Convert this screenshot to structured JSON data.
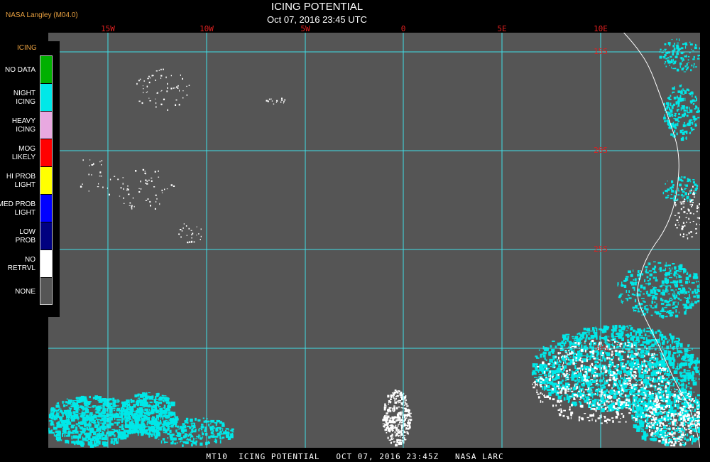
{
  "header": {
    "credit": "NASA Langley (M04.0)",
    "title": "ICING POTENTIAL",
    "subtitle": "Oct 07, 2016 23:45 UTC"
  },
  "map": {
    "longitude_labels": [
      "15W",
      "10W",
      "5W",
      "0",
      "5E",
      "10E"
    ],
    "latitude_labels": [
      "15S",
      "20S",
      "25S",
      "30S"
    ],
    "background_color": "#555555",
    "grid_color": "#40e0e8",
    "coast_color": "#ffffff",
    "cloud_color": "#00e8e8"
  },
  "legend": {
    "title": "ICING",
    "items": [
      {
        "label": "NO DATA",
        "color": "#00b000"
      },
      {
        "label": "NIGHT\nICING",
        "color": "#00e8e8"
      },
      {
        "label": "HEAVY\nICING",
        "color": "#e8a8e0"
      },
      {
        "label": "MOG\nLIKELY",
        "color": "#ff0000"
      },
      {
        "label": "HI PROB\nLIGHT",
        "color": "#ffff00"
      },
      {
        "label": "MED PROB\nLIGHT",
        "color": "#0000ff"
      },
      {
        "label": "LOW\nPROB",
        "color": "#000080"
      },
      {
        "label": "NO\nRETRVL",
        "color": "#ffffff"
      },
      {
        "label": "NONE",
        "color": "#555555"
      }
    ]
  },
  "footer": {
    "caption": "MT10  ICING POTENTIAL   OCT 07, 2016 23:45Z   NASA LARC"
  }
}
